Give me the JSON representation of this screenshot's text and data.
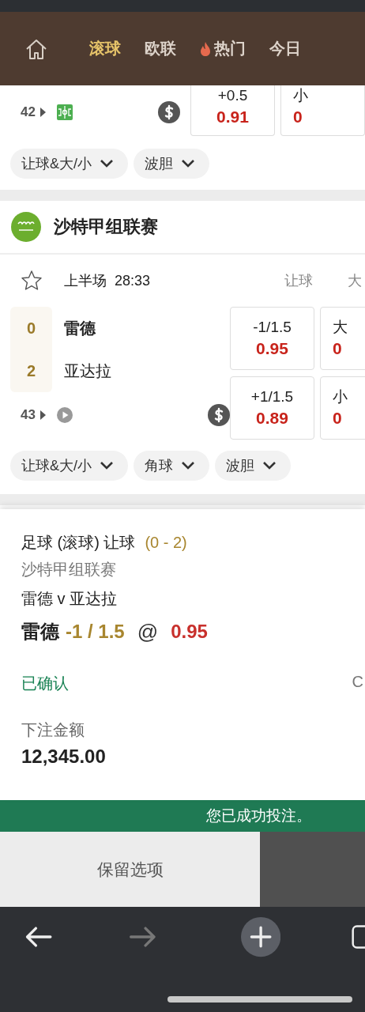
{
  "nav": {
    "tabs": [
      {
        "label": "滚球",
        "selected": true,
        "hot": false
      },
      {
        "label": "欧联",
        "selected": false,
        "hot": false
      },
      {
        "label": "热门",
        "selected": false,
        "hot": true
      },
      {
        "label": "今日",
        "selected": false,
        "hot": false
      }
    ]
  },
  "previous_match": {
    "number": "42",
    "odds": [
      {
        "line": "+0.5",
        "price": "0.91"
      },
      {
        "line": "小",
        "price": "0"
      }
    ],
    "chips": [
      "让球&大/小",
      "波胆"
    ]
  },
  "league": {
    "name": "沙特甲组联赛",
    "match": {
      "starred": false,
      "period": "上半场",
      "clock": "28:33",
      "market_headers": [
        "让球",
        "大"
      ],
      "teams": [
        {
          "name": "雷德",
          "score": "0",
          "highlighted": true
        },
        {
          "name": "亚达拉",
          "score": "2",
          "highlighted": false
        }
      ],
      "odds": [
        [
          {
            "line": "-1/1.5",
            "price": "0.95"
          },
          {
            "line": "大",
            "price": "0"
          }
        ],
        [
          {
            "line": "+1/1.5",
            "price": "0.89"
          },
          {
            "line": "小",
            "price": "0"
          }
        ]
      ],
      "number": "43",
      "chips": [
        "让球&大/小",
        "角球",
        "波胆"
      ]
    }
  },
  "bet_slip": {
    "title": "足球 (滚球) 让球",
    "score": "(0 - 2)",
    "league": "沙特甲组联赛",
    "fixture": "雷德 v 亚达拉",
    "selection": "雷德",
    "line": "-1 / 1.5",
    "at": "@",
    "price": "0.95",
    "status": "已确认",
    "status_side": "C",
    "stake_label": "下注金额",
    "stake": "12,345.00"
  },
  "toast": "您已成功投注。",
  "buttons": [
    {
      "kind": "light",
      "label": "保留选项"
    },
    {
      "kind": "dark"
    }
  ],
  "browser_toolbar": {
    "back_disabled": false,
    "forward_disabled": true
  }
}
